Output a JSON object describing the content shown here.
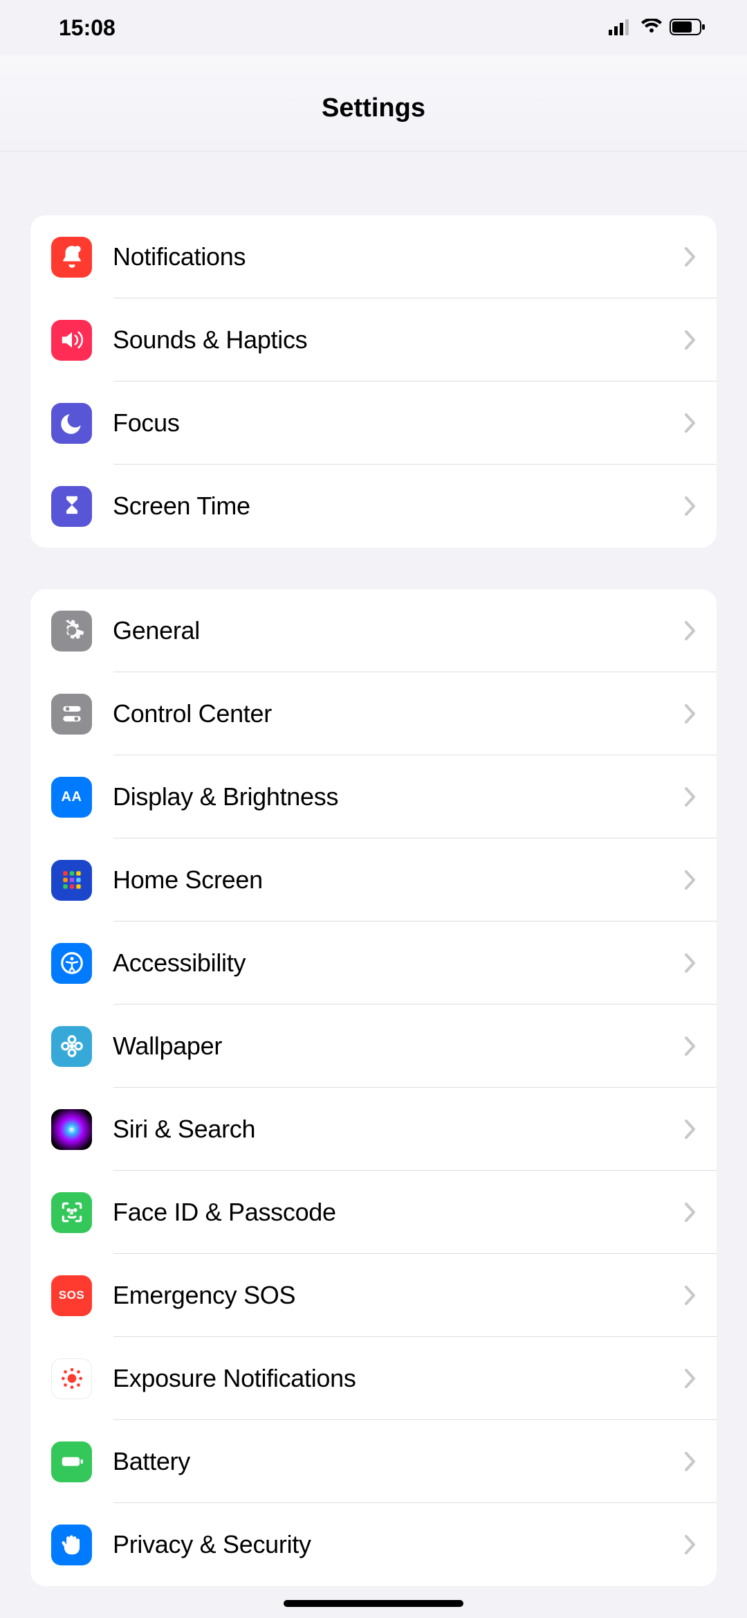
{
  "status": {
    "time": "15:08"
  },
  "header": {
    "title": "Settings"
  },
  "section1": [
    {
      "label": "Notifications"
    },
    {
      "label": "Sounds & Haptics"
    },
    {
      "label": "Focus"
    },
    {
      "label": "Screen Time"
    }
  ],
  "section2": [
    {
      "label": "General"
    },
    {
      "label": "Control Center"
    },
    {
      "label": "Display & Brightness"
    },
    {
      "label": "Home Screen"
    },
    {
      "label": "Accessibility"
    },
    {
      "label": "Wallpaper"
    },
    {
      "label": "Siri & Search"
    },
    {
      "label": "Face ID & Passcode"
    },
    {
      "label": "Emergency SOS"
    },
    {
      "label": "Exposure Notifications"
    },
    {
      "label": "Battery"
    },
    {
      "label": "Privacy & Security"
    }
  ],
  "icons": {
    "sos_text": "SOS",
    "aa_text": "AA"
  }
}
